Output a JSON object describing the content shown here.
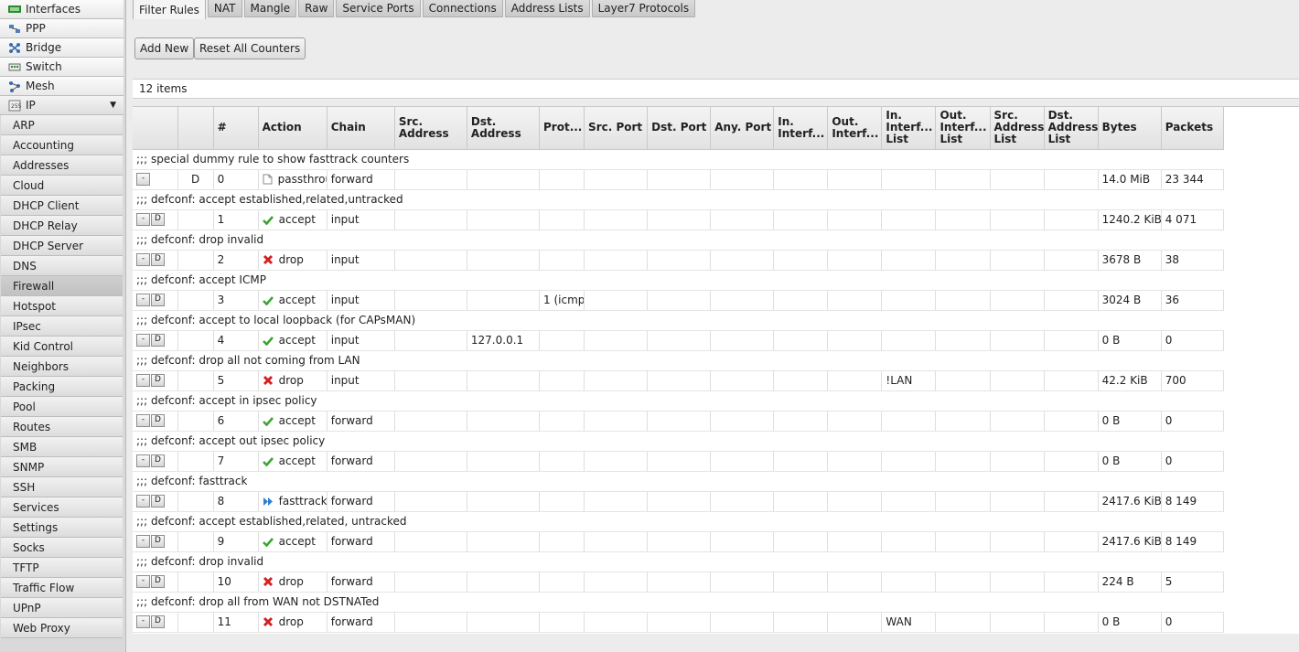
{
  "sidebar": {
    "top_items": [
      {
        "label": "Interfaces",
        "icon": "interfaces-icon"
      },
      {
        "label": "PPP",
        "icon": "ppp-icon"
      },
      {
        "label": "Bridge",
        "icon": "bridge-icon"
      },
      {
        "label": "Switch",
        "icon": "switch-icon"
      },
      {
        "label": "Mesh",
        "icon": "mesh-icon"
      },
      {
        "label": "IP",
        "icon": "ip-icon",
        "arrow": "▼"
      }
    ],
    "ip_items": [
      "ARP",
      "Accounting",
      "Addresses",
      "Cloud",
      "DHCP Client",
      "DHCP Relay",
      "DHCP Server",
      "DNS",
      "Firewall",
      "Hotspot",
      "IPsec",
      "Kid Control",
      "Neighbors",
      "Packing",
      "Pool",
      "Routes",
      "SMB",
      "SNMP",
      "SSH",
      "Services",
      "Settings",
      "Socks",
      "TFTP",
      "Traffic Flow",
      "UPnP",
      "Web Proxy"
    ],
    "active": "Firewall"
  },
  "tabs": [
    "Filter Rules",
    "NAT",
    "Mangle",
    "Raw",
    "Service Ports",
    "Connections",
    "Address Lists",
    "Layer7 Protocols"
  ],
  "active_tab": "Filter Rules",
  "toolbar": {
    "add_new": "Add New",
    "reset_counters": "Reset All Counters"
  },
  "item_count": "12 items",
  "columns": [
    "",
    "",
    "#",
    "Action",
    "Chain",
    "Src.\nAddress",
    "Dst.\nAddress",
    "Prot...",
    "Src. Port",
    "Dst. Port",
    "Any. Port",
    "In.\nInterf...",
    "Out.\nInterf...",
    "In.\nInterf...\nList",
    "Out.\nInterf...\nList",
    "Src.\nAddress\nList",
    "Dst.\nAddress\nList",
    "Bytes",
    "Packets"
  ],
  "rules": [
    {
      "comment": ";;; special dummy rule to show fasttrack counters",
      "dynamic": true,
      "flag": "D",
      "num": "0",
      "action": "passthrough",
      "action_icon": "passthrough-icon",
      "chain": "forward",
      "dst_address": "",
      "protocol": "",
      "in_interface_list": "",
      "bytes": "14.0 MiB",
      "packets": "23 344"
    },
    {
      "comment": ";;; defconf: accept established,related,untracked",
      "num": "1",
      "action": "accept",
      "action_icon": "check-icon",
      "chain": "input",
      "dst_address": "",
      "protocol": "",
      "in_interface_list": "",
      "bytes": "1240.2 KiB",
      "packets": "4 071"
    },
    {
      "comment": ";;; defconf: drop invalid",
      "num": "2",
      "action": "drop",
      "action_icon": "drop-icon",
      "chain": "input",
      "dst_address": "",
      "protocol": "",
      "in_interface_list": "",
      "bytes": "3678 B",
      "packets": "38"
    },
    {
      "comment": ";;; defconf: accept ICMP",
      "num": "3",
      "action": "accept",
      "action_icon": "check-icon",
      "chain": "input",
      "dst_address": "",
      "protocol": "1 (icmp",
      "in_interface_list": "",
      "bytes": "3024 B",
      "packets": "36"
    },
    {
      "comment": ";;; defconf: accept to local loopback (for CAPsMAN)",
      "num": "4",
      "action": "accept",
      "action_icon": "check-icon",
      "chain": "input",
      "dst_address": "127.0.0.1",
      "protocol": "",
      "in_interface_list": "",
      "bytes": "0 B",
      "packets": "0"
    },
    {
      "comment": ";;; defconf: drop all not coming from LAN",
      "num": "5",
      "action": "drop",
      "action_icon": "drop-icon",
      "chain": "input",
      "dst_address": "",
      "protocol": "",
      "in_interface_list": "!LAN",
      "bytes": "42.2 KiB",
      "packets": "700"
    },
    {
      "comment": ";;; defconf: accept in ipsec policy",
      "num": "6",
      "action": "accept",
      "action_icon": "check-icon",
      "chain": "forward",
      "dst_address": "",
      "protocol": "",
      "in_interface_list": "",
      "bytes": "0 B",
      "packets": "0"
    },
    {
      "comment": ";;; defconf: accept out ipsec policy",
      "num": "7",
      "action": "accept",
      "action_icon": "check-icon",
      "chain": "forward",
      "dst_address": "",
      "protocol": "",
      "in_interface_list": "",
      "bytes": "0 B",
      "packets": "0"
    },
    {
      "comment": ";;; defconf: fasttrack",
      "num": "8",
      "action": "fasttrack",
      "action_icon": "fasttrack-icon",
      "chain": "forward",
      "dst_address": "",
      "protocol": "",
      "in_interface_list": "",
      "bytes": "2417.6 KiB",
      "packets": "8 149"
    },
    {
      "comment": ";;; defconf: accept established,related, untracked",
      "num": "9",
      "action": "accept",
      "action_icon": "check-icon",
      "chain": "forward",
      "dst_address": "",
      "protocol": "",
      "in_interface_list": "",
      "bytes": "2417.6 KiB",
      "packets": "8 149"
    },
    {
      "comment": ";;; defconf: drop invalid",
      "num": "10",
      "action": "drop",
      "action_icon": "drop-icon",
      "chain": "forward",
      "dst_address": "",
      "protocol": "",
      "in_interface_list": "",
      "bytes": "224 B",
      "packets": "5"
    },
    {
      "comment": ";;; defconf: drop all from WAN not DSTNATed",
      "num": "11",
      "action": "drop",
      "action_icon": "drop-icon",
      "chain": "forward",
      "dst_address": "",
      "protocol": "",
      "in_interface_list": "WAN",
      "bytes": "0 B",
      "packets": "0"
    }
  ],
  "row_buttons": {
    "remove": "-",
    "disable": "D"
  },
  "colors": {
    "accept": "#3aa534",
    "drop": "#d32020",
    "fasttrack": "#2f7fd0"
  }
}
